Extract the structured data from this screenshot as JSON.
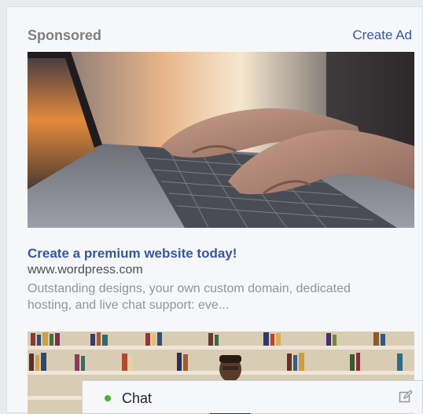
{
  "header": {
    "title": "Sponsored",
    "create_ad_label": "Create Ad"
  },
  "ad": {
    "title": "Create a premium website today!",
    "url": "www.wordpress.com",
    "description": "Outstanding designs, your own custom domain, dedicated hosting, and live chat support: eve..."
  },
  "chat": {
    "label": "Chat",
    "status_color": "#42b72a",
    "compose_icon": "compose-icon"
  },
  "colors": {
    "link": "#365899",
    "muted": "#90949c",
    "card_bg": "#f6f7f9"
  }
}
